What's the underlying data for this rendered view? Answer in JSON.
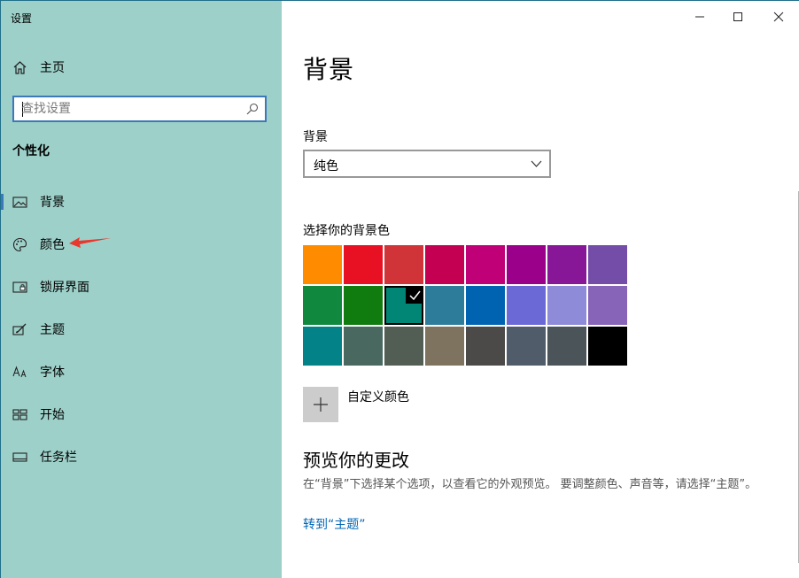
{
  "window": {
    "title": "设置",
    "controls": [
      "minimize",
      "maximize",
      "close"
    ]
  },
  "sidebar": {
    "home_label": "主页",
    "search_placeholder": "查找设置",
    "section_title": "个性化",
    "items": [
      {
        "label": "背景",
        "icon": "picture-icon",
        "active": true
      },
      {
        "label": "颜色",
        "icon": "palette-icon",
        "active": false
      },
      {
        "label": "锁屏界面",
        "icon": "lock-screen-icon",
        "active": false
      },
      {
        "label": "主题",
        "icon": "theme-icon",
        "active": false
      },
      {
        "label": "字体",
        "icon": "font-icon",
        "active": false
      },
      {
        "label": "开始",
        "icon": "start-icon",
        "active": false
      },
      {
        "label": "任务栏",
        "icon": "taskbar-icon",
        "active": false
      }
    ]
  },
  "main": {
    "title": "背景",
    "background_label": "背景",
    "background_value": "纯色",
    "color_label": "选择你的背景色",
    "colors": [
      "#ff8c00",
      "#e81123",
      "#d13438",
      "#c30052",
      "#bf0077",
      "#9a0089",
      "#881798",
      "#744da9",
      "#10893e",
      "#107c10",
      "#018574",
      "#2d7d9a",
      "#0063b1",
      "#6b69d6",
      "#8e8cd8",
      "#8764b8",
      "#038387",
      "#486860",
      "#525e54",
      "#7e735f",
      "#4c4a48",
      "#515c6b",
      "#4a5459",
      "#000000"
    ],
    "selected_color_index": 10,
    "custom_color_label": "自定义颜色",
    "preview_title": "预览你的更改",
    "preview_desc": "在“背景”下选择某个选项，以查看它的外观预览。 要调整颜色、声音等，请选择“主题”。",
    "goto_link": "转到“主题”"
  }
}
